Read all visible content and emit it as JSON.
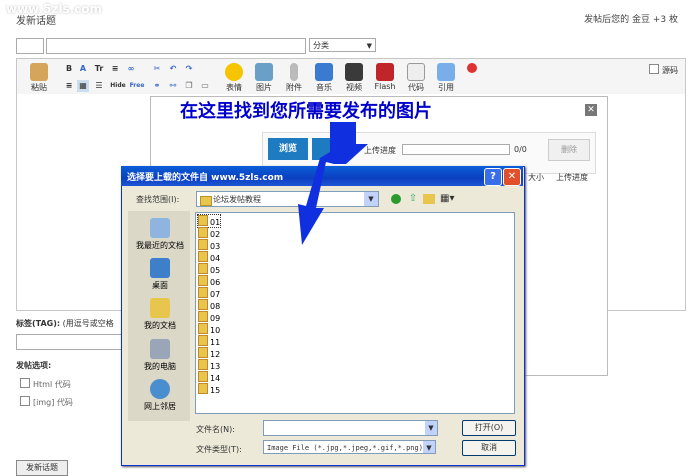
{
  "watermark": "www.5zls.com",
  "page": {
    "title": "发新话题",
    "reward": "发帖后您的 金豆 +3 枚"
  },
  "post_form": {
    "category_label": "分类",
    "toolbar": {
      "buttons": [
        "粘贴",
        "表情",
        "图片",
        "附件",
        "音乐",
        "视频",
        "Flash",
        "代码",
        "引用"
      ],
      "small_buttons": [
        "B",
        "Tr",
        "Hide",
        "Free"
      ]
    },
    "source_mode_label": "源码",
    "tag_label": "标签(TAG):",
    "tag_hint": "(用逗号或空格",
    "options_title": "发帖选项:",
    "option_html": "Html 代码",
    "option_img": "[img] 代码",
    "submit_label": "发新话题"
  },
  "upload_panel": {
    "browse_label": "浏览",
    "progress_label": "上传进度",
    "progress_value": "0/0",
    "progress_fraction": 0,
    "delete_label": "删除",
    "col_size": "大小",
    "col_progress": "上传进度"
  },
  "file_dialog": {
    "title": "选择要上载的文件自 www.5zls.com",
    "look_in_label": "查找范围(I):",
    "look_in_value": "论坛发帖教程",
    "places": [
      "我最近的文档",
      "桌面",
      "我的文档",
      "我的电脑",
      "网上邻居"
    ],
    "files": [
      "01",
      "02",
      "03",
      "04",
      "05",
      "06",
      "07",
      "08",
      "09",
      "10",
      "11",
      "12",
      "13",
      "14",
      "15"
    ],
    "filename_label": "文件名(N):",
    "filename_value": "",
    "filetype_label": "文件类型(T):",
    "filetype_value": "Image File (*.jpg,*.jpeg,*.gif,*.png)",
    "open_label": "打开(O)",
    "cancel_label": "取消"
  },
  "annotation": "在这里找到您所需要发布的图片"
}
